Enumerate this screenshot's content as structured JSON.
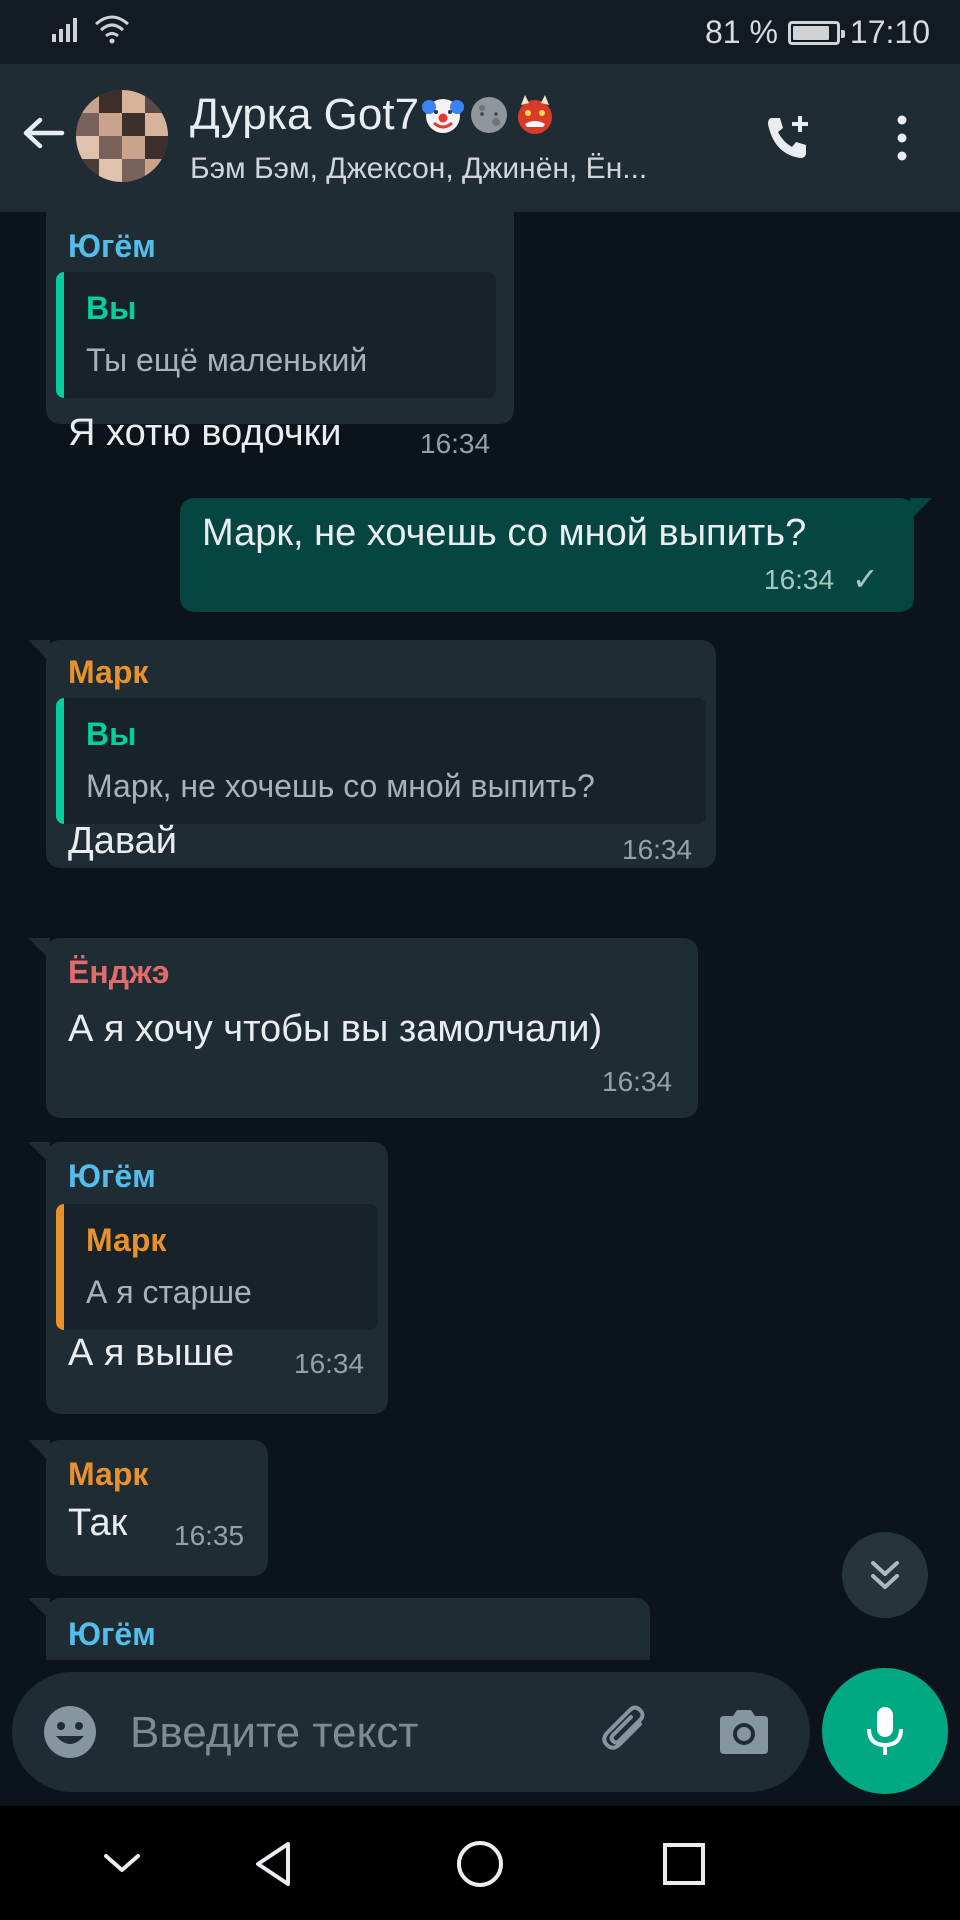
{
  "status_bar": {
    "battery": "81 %",
    "battery_level": 0.81,
    "time": "17:10"
  },
  "header": {
    "title": "Дурка Got7",
    "title_emojis": [
      "clown-face",
      "new-moon-face",
      "ogre"
    ],
    "subtitle": "Бэм Бэм, Джексон, Джинён, Ён...",
    "icons": [
      "back-arrow-icon",
      "group-avatar",
      "add-call-icon",
      "more-vert-icon"
    ]
  },
  "messages": [
    {
      "direction": "in",
      "sender": "Югём",
      "sender_color": "#53bdeb",
      "quote": {
        "name": "Вы",
        "name_color": "#06cf9c",
        "text": "Ты ещё маленький",
        "bar_color": "#06cf9c"
      },
      "text": "Я хотю водочки",
      "time": "16:34"
    },
    {
      "direction": "out",
      "text": "Марк, не хочешь со мной выпить?",
      "time": "16:34",
      "status": "✓"
    },
    {
      "direction": "in",
      "sender": "Марк",
      "sender_color": "#e8912d",
      "quote": {
        "name": "Вы",
        "name_color": "#06cf9c",
        "text": "Марк, не хочешь со мной выпить?",
        "bar_color": "#06cf9c"
      },
      "text": "Давай",
      "time": "16:34"
    },
    {
      "direction": "in",
      "sender": "Ёнджэ",
      "sender_color": "#e26b6b",
      "text": "А я хочу чтобы вы замолчали)",
      "time": "16:34"
    },
    {
      "direction": "in",
      "sender": "Югём",
      "sender_color": "#53bdeb",
      "quote": {
        "name": "Марк",
        "name_color": "#e8912d",
        "text": "А я старше",
        "bar_color": "#e8912d"
      },
      "text": "А я выше",
      "time": "16:34"
    },
    {
      "direction": "in",
      "sender": "Марк",
      "sender_color": "#e8912d",
      "text": "Так",
      "time": "16:35"
    },
    {
      "direction": "in",
      "sender": "Югём",
      "sender_color": "#53bdeb"
    }
  ],
  "composer": {
    "placeholder": "Введите текст",
    "icons": [
      "emoji-icon",
      "attach-icon",
      "camera-icon",
      "mic-icon"
    ]
  },
  "scroll_down": {
    "icon": "double-chevron-down-icon"
  },
  "nav_bar": {
    "icons": [
      "hide-keyboard-icon",
      "back-triangle-icon",
      "home-circle-icon",
      "recents-square-icon"
    ]
  }
}
